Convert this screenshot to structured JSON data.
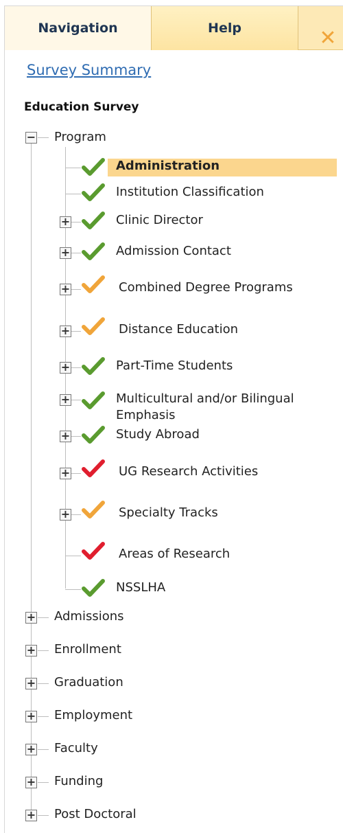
{
  "tabs": {
    "navigation": "Navigation",
    "help": "Help",
    "close_symbol": "✕"
  },
  "summary_link": "Survey Summary",
  "section_title": "Education Survey",
  "program": {
    "label": "Program",
    "expander": "−",
    "items": [
      {
        "label": "Administration",
        "status": "green",
        "expander": ""
      },
      {
        "label": "Institution Classification",
        "status": "green",
        "expander": ""
      },
      {
        "label": "Clinic Director",
        "status": "green",
        "expander": "+"
      },
      {
        "label": "Admission Contact",
        "status": "green",
        "expander": "+"
      },
      {
        "label": "Combined Degree Programs",
        "status": "orange",
        "expander": "+"
      },
      {
        "label": "Distance Education",
        "status": "orange",
        "expander": "+"
      },
      {
        "label": "Part-Time Students",
        "status": "green",
        "expander": "+"
      },
      {
        "label": "Multicultural and/or Bilingual Emphasis",
        "status": "green",
        "expander": "+"
      },
      {
        "label": "Study Abroad",
        "status": "green",
        "expander": "+"
      },
      {
        "label": "UG Research Activities",
        "status": "red",
        "expander": "+"
      },
      {
        "label": "Specialty Tracks",
        "status": "orange",
        "expander": "+"
      },
      {
        "label": "Areas of Research",
        "status": "red",
        "expander": ""
      },
      {
        "label": "NSSLHA",
        "status": "green",
        "expander": ""
      }
    ]
  },
  "top_sections": [
    {
      "label": "Admissions",
      "expander": "+"
    },
    {
      "label": "Enrollment",
      "expander": "+"
    },
    {
      "label": "Graduation",
      "expander": "+"
    },
    {
      "label": "Employment",
      "expander": "+"
    },
    {
      "label": "Faculty",
      "expander": "+"
    },
    {
      "label": "Funding",
      "expander": "+"
    },
    {
      "label": "Post Doctoral",
      "expander": "+"
    }
  ],
  "colors": {
    "green": "#5a9b2f",
    "orange": "#f0a53a",
    "red": "#e01e2e",
    "selected_highlight": "#fbd68e"
  }
}
